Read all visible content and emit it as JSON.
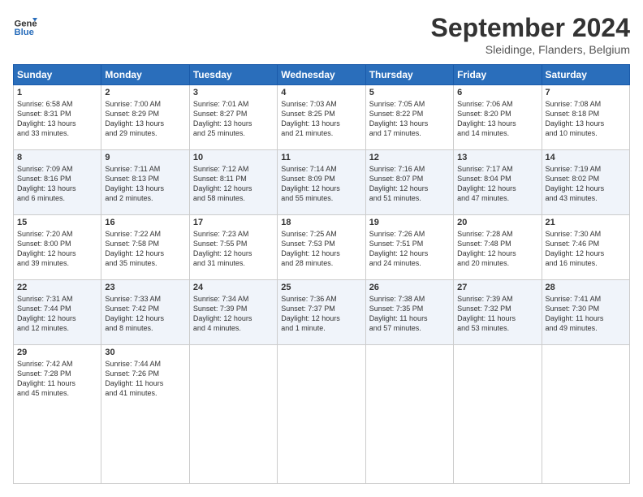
{
  "logo": {
    "line1": "General",
    "line2": "Blue"
  },
  "title": "September 2024",
  "subtitle": "Sleidinge, Flanders, Belgium",
  "headers": [
    "Sunday",
    "Monday",
    "Tuesday",
    "Wednesday",
    "Thursday",
    "Friday",
    "Saturday"
  ],
  "weeks": [
    [
      {
        "num": "1",
        "info": "Sunrise: 6:58 AM\nSunset: 8:31 PM\nDaylight: 13 hours\nand 33 minutes."
      },
      {
        "num": "2",
        "info": "Sunrise: 7:00 AM\nSunset: 8:29 PM\nDaylight: 13 hours\nand 29 minutes."
      },
      {
        "num": "3",
        "info": "Sunrise: 7:01 AM\nSunset: 8:27 PM\nDaylight: 13 hours\nand 25 minutes."
      },
      {
        "num": "4",
        "info": "Sunrise: 7:03 AM\nSunset: 8:25 PM\nDaylight: 13 hours\nand 21 minutes."
      },
      {
        "num": "5",
        "info": "Sunrise: 7:05 AM\nSunset: 8:22 PM\nDaylight: 13 hours\nand 17 minutes."
      },
      {
        "num": "6",
        "info": "Sunrise: 7:06 AM\nSunset: 8:20 PM\nDaylight: 13 hours\nand 14 minutes."
      },
      {
        "num": "7",
        "info": "Sunrise: 7:08 AM\nSunset: 8:18 PM\nDaylight: 13 hours\nand 10 minutes."
      }
    ],
    [
      {
        "num": "8",
        "info": "Sunrise: 7:09 AM\nSunset: 8:16 PM\nDaylight: 13 hours\nand 6 minutes."
      },
      {
        "num": "9",
        "info": "Sunrise: 7:11 AM\nSunset: 8:13 PM\nDaylight: 13 hours\nand 2 minutes."
      },
      {
        "num": "10",
        "info": "Sunrise: 7:12 AM\nSunset: 8:11 PM\nDaylight: 12 hours\nand 58 minutes."
      },
      {
        "num": "11",
        "info": "Sunrise: 7:14 AM\nSunset: 8:09 PM\nDaylight: 12 hours\nand 55 minutes."
      },
      {
        "num": "12",
        "info": "Sunrise: 7:16 AM\nSunset: 8:07 PM\nDaylight: 12 hours\nand 51 minutes."
      },
      {
        "num": "13",
        "info": "Sunrise: 7:17 AM\nSunset: 8:04 PM\nDaylight: 12 hours\nand 47 minutes."
      },
      {
        "num": "14",
        "info": "Sunrise: 7:19 AM\nSunset: 8:02 PM\nDaylight: 12 hours\nand 43 minutes."
      }
    ],
    [
      {
        "num": "15",
        "info": "Sunrise: 7:20 AM\nSunset: 8:00 PM\nDaylight: 12 hours\nand 39 minutes."
      },
      {
        "num": "16",
        "info": "Sunrise: 7:22 AM\nSunset: 7:58 PM\nDaylight: 12 hours\nand 35 minutes."
      },
      {
        "num": "17",
        "info": "Sunrise: 7:23 AM\nSunset: 7:55 PM\nDaylight: 12 hours\nand 31 minutes."
      },
      {
        "num": "18",
        "info": "Sunrise: 7:25 AM\nSunset: 7:53 PM\nDaylight: 12 hours\nand 28 minutes."
      },
      {
        "num": "19",
        "info": "Sunrise: 7:26 AM\nSunset: 7:51 PM\nDaylight: 12 hours\nand 24 minutes."
      },
      {
        "num": "20",
        "info": "Sunrise: 7:28 AM\nSunset: 7:48 PM\nDaylight: 12 hours\nand 20 minutes."
      },
      {
        "num": "21",
        "info": "Sunrise: 7:30 AM\nSunset: 7:46 PM\nDaylight: 12 hours\nand 16 minutes."
      }
    ],
    [
      {
        "num": "22",
        "info": "Sunrise: 7:31 AM\nSunset: 7:44 PM\nDaylight: 12 hours\nand 12 minutes."
      },
      {
        "num": "23",
        "info": "Sunrise: 7:33 AM\nSunset: 7:42 PM\nDaylight: 12 hours\nand 8 minutes."
      },
      {
        "num": "24",
        "info": "Sunrise: 7:34 AM\nSunset: 7:39 PM\nDaylight: 12 hours\nand 4 minutes."
      },
      {
        "num": "25",
        "info": "Sunrise: 7:36 AM\nSunset: 7:37 PM\nDaylight: 12 hours\nand 1 minute."
      },
      {
        "num": "26",
        "info": "Sunrise: 7:38 AM\nSunset: 7:35 PM\nDaylight: 11 hours\nand 57 minutes."
      },
      {
        "num": "27",
        "info": "Sunrise: 7:39 AM\nSunset: 7:32 PM\nDaylight: 11 hours\nand 53 minutes."
      },
      {
        "num": "28",
        "info": "Sunrise: 7:41 AM\nSunset: 7:30 PM\nDaylight: 11 hours\nand 49 minutes."
      }
    ],
    [
      {
        "num": "29",
        "info": "Sunrise: 7:42 AM\nSunset: 7:28 PM\nDaylight: 11 hours\nand 45 minutes."
      },
      {
        "num": "30",
        "info": "Sunrise: 7:44 AM\nSunset: 7:26 PM\nDaylight: 11 hours\nand 41 minutes."
      },
      {
        "num": "",
        "info": ""
      },
      {
        "num": "",
        "info": ""
      },
      {
        "num": "",
        "info": ""
      },
      {
        "num": "",
        "info": ""
      },
      {
        "num": "",
        "info": ""
      }
    ]
  ]
}
